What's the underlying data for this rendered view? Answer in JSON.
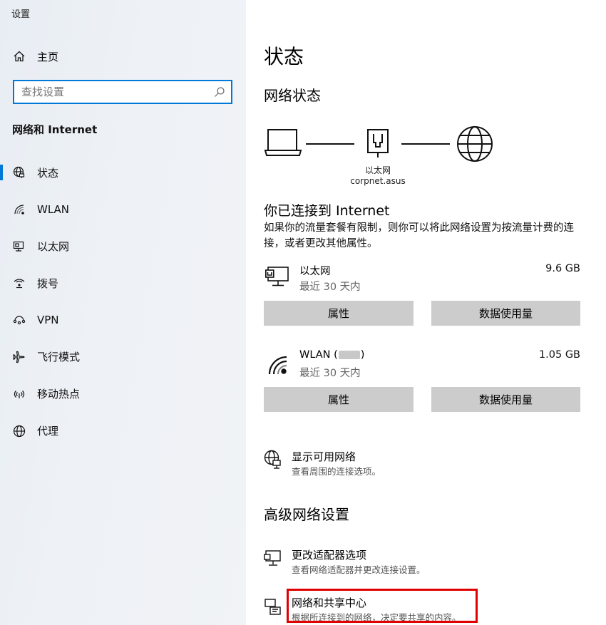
{
  "window_title": "设置",
  "sidebar": {
    "home_label": "主页",
    "search_placeholder": "查找设置",
    "section_title": "网络和 Internet",
    "items": [
      {
        "label": "状态",
        "icon": "globe-status-icon"
      },
      {
        "label": "WLAN",
        "icon": "wifi-icon"
      },
      {
        "label": "以太网",
        "icon": "ethernet-icon"
      },
      {
        "label": "拨号",
        "icon": "dialup-icon"
      },
      {
        "label": "VPN",
        "icon": "vpn-icon"
      },
      {
        "label": "飞行模式",
        "icon": "airplane-icon"
      },
      {
        "label": "移动热点",
        "icon": "hotspot-icon"
      },
      {
        "label": "代理",
        "icon": "proxy-globe-icon"
      }
    ]
  },
  "main": {
    "title": "状态",
    "network_status_title": "网络状态",
    "diagram": {
      "adapter_label": "以太网",
      "network_name": "corpnet.asus"
    },
    "connected_title": "你已连接到 Internet",
    "connected_desc": "如果你的流量套餐有限制，则你可以将此网络设置为按流量计费的连接，或者更改其他属性。",
    "adapters": [
      {
        "name": "以太网",
        "sub": "最近 30 天内",
        "usage": "9.6 GB",
        "properties_label": "属性",
        "data_usage_label": "数据使用量"
      },
      {
        "name_prefix": "WLAN (",
        "name_suffix": ")",
        "sub": "最近 30 天内",
        "usage": "1.05 GB",
        "properties_label": "属性",
        "data_usage_label": "数据使用量"
      }
    ],
    "show_networks": {
      "title": "显示可用网络",
      "sub": "查看周围的连接选项。"
    },
    "advanced_title": "高级网络设置",
    "change_adapter": {
      "title": "更改适配器选项",
      "sub": "查看网络适配器并更改连接设置。"
    },
    "sharing_center": {
      "title": "网络和共享中心",
      "sub": "根据所连接到的网络，决定要共享的内容。"
    }
  },
  "colors": {
    "accent": "#0078d7",
    "button_bg": "#cccccc",
    "highlight_border": "#e10000",
    "sidebar_bg": "#eef2f6"
  }
}
